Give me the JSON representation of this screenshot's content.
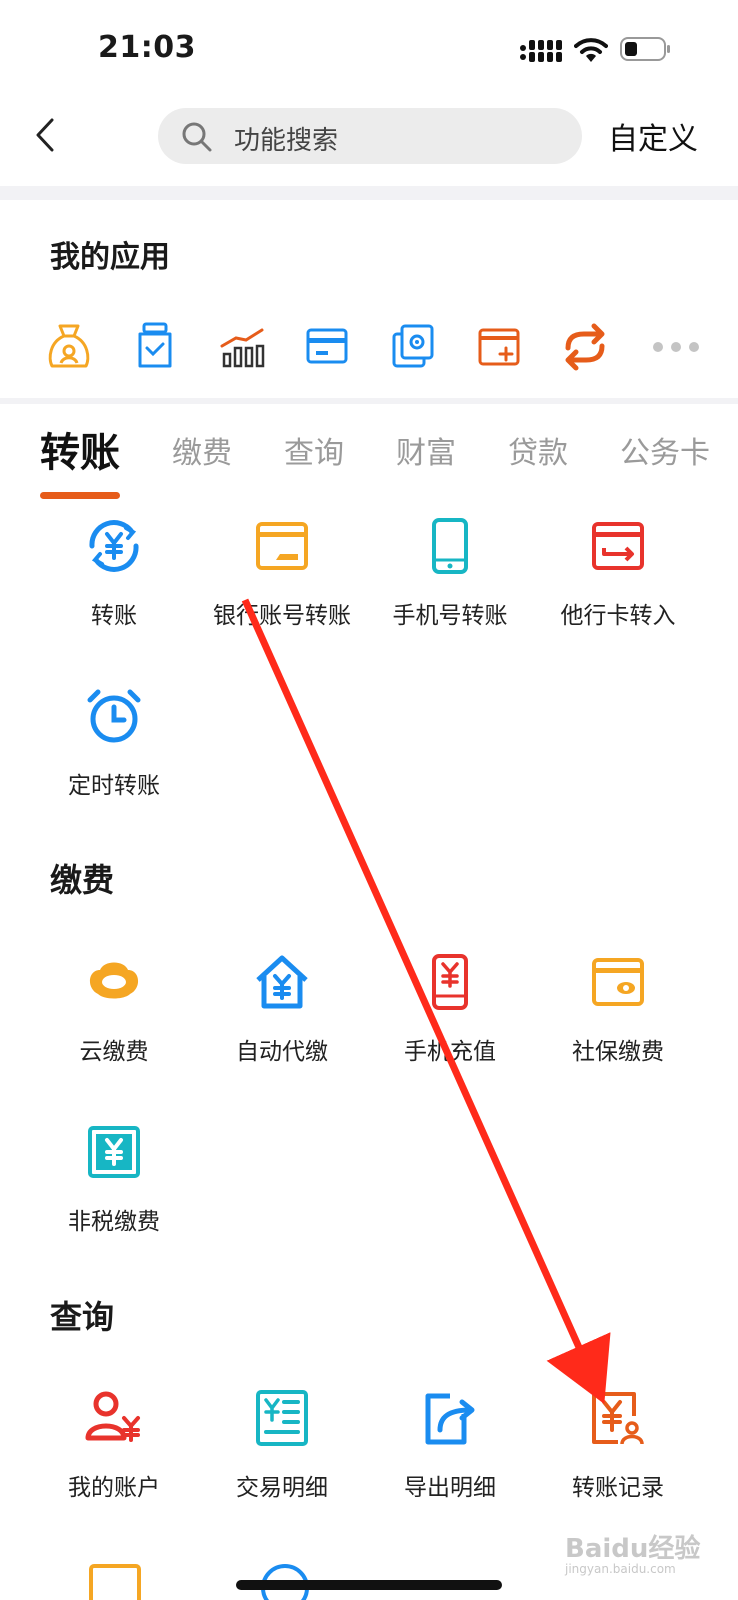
{
  "status_bar": {
    "time": "21:03"
  },
  "nav": {
    "search_placeholder": "功能搜索",
    "customize_label": "自定义"
  },
  "my_apps": {
    "title": "我的应用",
    "icons": [
      "money-bag-icon",
      "timer-jar-icon",
      "chart-icon",
      "card-icon",
      "settings-card-icon",
      "add-card-icon",
      "refresh-icon"
    ]
  },
  "tabs": [
    "转账",
    "缴费",
    "查询",
    "财富",
    "贷款",
    "公务卡"
  ],
  "transfer": {
    "items": [
      {
        "label": "转账",
        "icon": "yuan-cycle-icon"
      },
      {
        "label": "银行账号转账",
        "icon": "bank-card-icon"
      },
      {
        "label": "手机号转账",
        "icon": "phone-icon"
      },
      {
        "label": "他行卡转入",
        "icon": "card-in-icon"
      },
      {
        "label": "定时转账",
        "icon": "alarm-clock-icon"
      }
    ]
  },
  "payment": {
    "title": "缴费",
    "items": [
      {
        "label": "云缴费",
        "icon": "cloud-icon"
      },
      {
        "label": "自动代缴",
        "icon": "house-yuan-icon"
      },
      {
        "label": "手机充值",
        "icon": "phone-yuan-icon"
      },
      {
        "label": "社保缴费",
        "icon": "social-card-icon"
      },
      {
        "label": "非税缴费",
        "icon": "tax-yuan-icon"
      }
    ]
  },
  "query": {
    "title": "查询",
    "items": [
      {
        "label": "我的账户",
        "icon": "account-icon"
      },
      {
        "label": "交易明细",
        "icon": "detail-list-icon"
      },
      {
        "label": "导出明细",
        "icon": "export-icon"
      },
      {
        "label": "转账记录",
        "icon": "transfer-record-icon"
      }
    ]
  },
  "watermark": {
    "main": "Baidu经验",
    "sub": "jingyan.baidu.com"
  },
  "colors": {
    "accent": "#e65c1a",
    "blue": "#1a8cf0",
    "orange": "#f5a623",
    "red": "#e8332c",
    "teal": "#17b6c4",
    "arrow": "#ff2a1a"
  }
}
